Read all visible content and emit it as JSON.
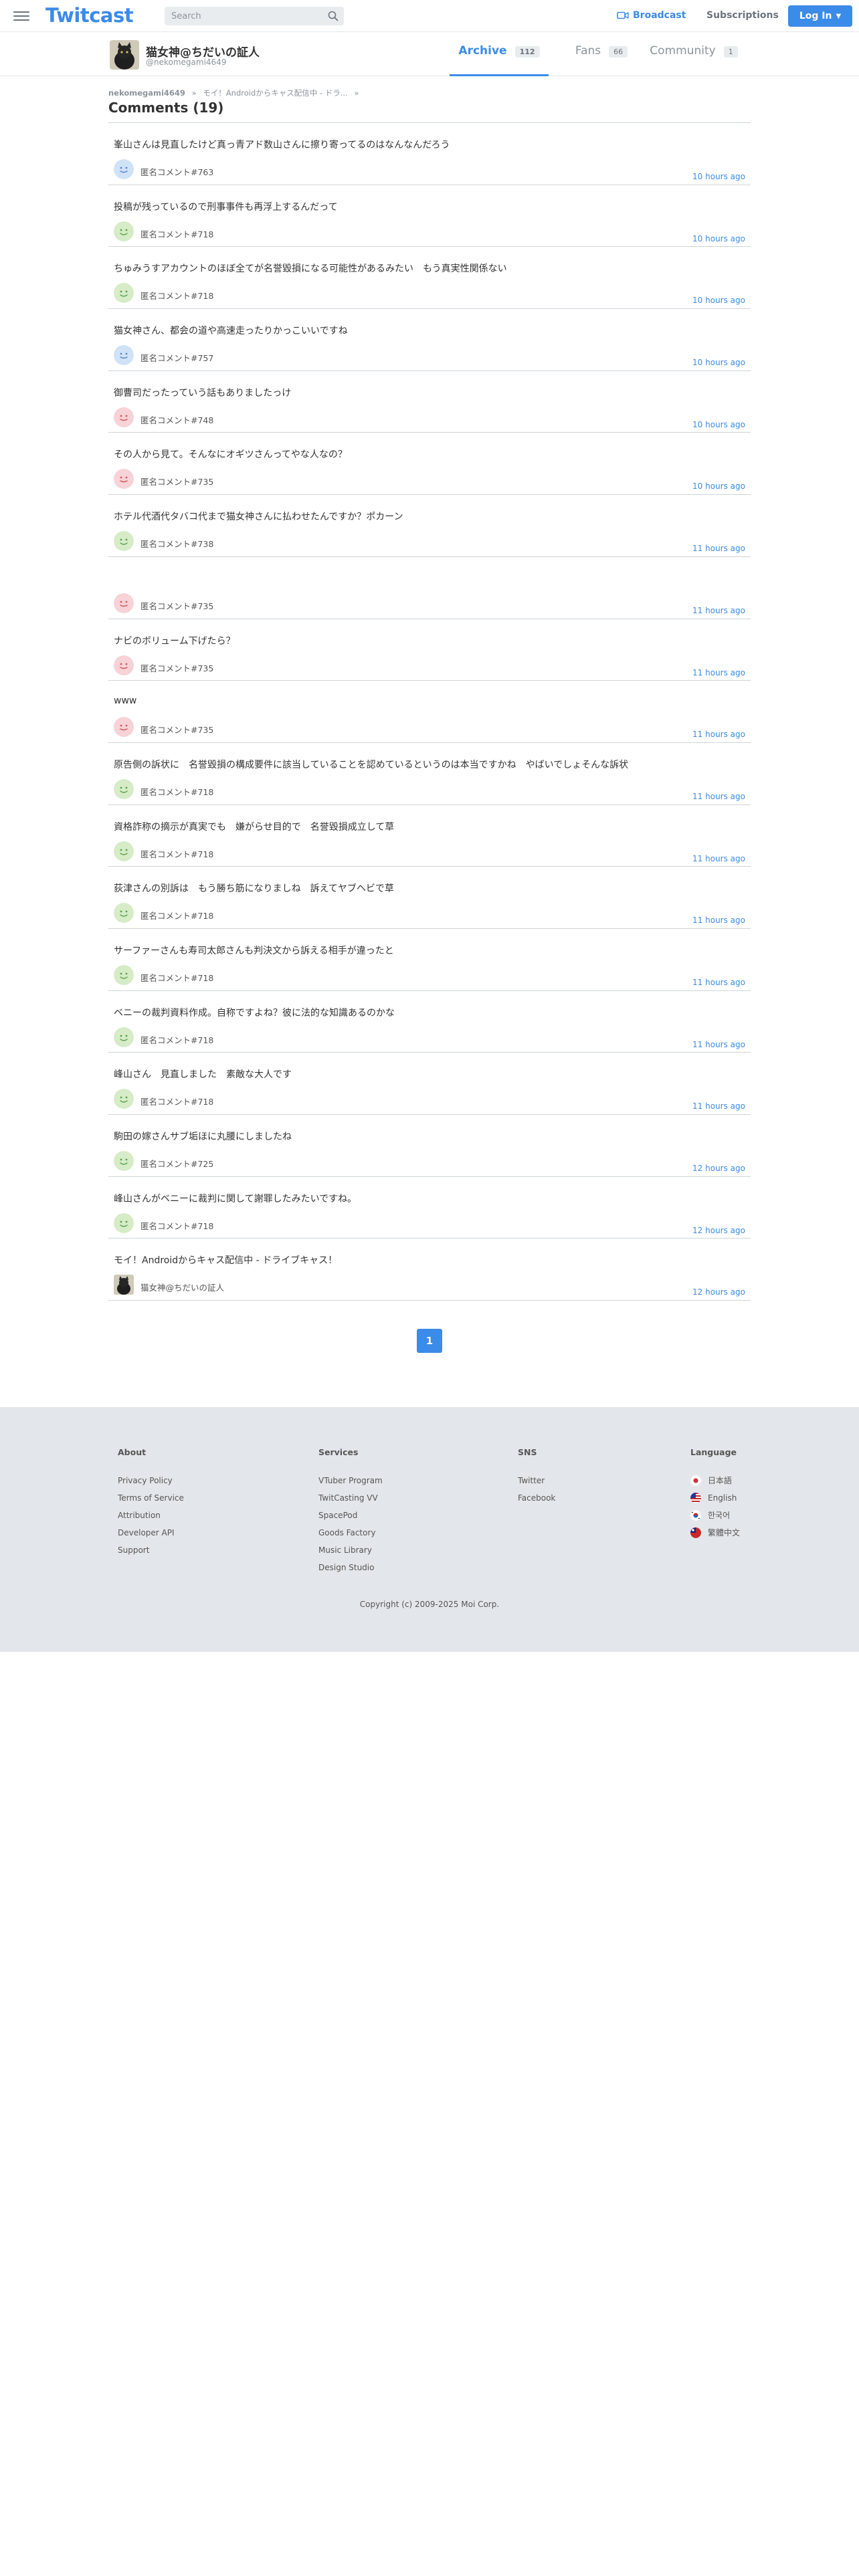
{
  "header": {
    "logo": "Twitcast",
    "search_placeholder": "Search",
    "broadcast": "Broadcast",
    "subscriptions": "Subscriptions",
    "login": "Log In",
    "accent": "#3b8be8"
  },
  "profile": {
    "name": "猫女神@ちだいの証人",
    "handle": "@nekomegami4649",
    "tabs": [
      {
        "label": "Archive",
        "count": "112"
      },
      {
        "label": "Fans",
        "count": "66"
      },
      {
        "label": "Community",
        "count": "1"
      }
    ]
  },
  "breadcrumb": {
    "user": "nekomegami4649",
    "page": "モイ！Androidからキャス配信中 - ドラ..."
  },
  "title": "Comments (19)",
  "comments": [
    {
      "text": "峯山さんは見直したけど真っ青アド数山さんに擦り寄ってるのはなんなんだろう",
      "author": "匿名コメント#763",
      "time": "10 hours ago",
      "face": "blue"
    },
    {
      "text": "投稿が残っているので刑事事件も再浮上するんだって",
      "author": "匿名コメント#718",
      "time": "10 hours ago",
      "face": "green"
    },
    {
      "text": "ちゅみうすアカウントのほぼ全てが名誉毀損になる可能性があるみたい　もう真実性関係ない",
      "author": "匿名コメント#718",
      "time": "10 hours ago",
      "face": "green"
    },
    {
      "text": "猫女神さん、都会の道や高速走ったりかっこいいですね",
      "author": "匿名コメント#757",
      "time": "10 hours ago",
      "face": "blue"
    },
    {
      "text": "御曹司だったっていう話もありましたっけ",
      "author": "匿名コメント#748",
      "time": "10 hours ago",
      "face": "red"
    },
    {
      "text": "その人から見て。そんなにオギツさんってやな人なの？",
      "author": "匿名コメント#735",
      "time": "10 hours ago",
      "face": "red"
    },
    {
      "text": "ホテル代酒代タバコ代まで猫女神さんに払わせたんですか？ポカーン",
      "author": "匿名コメント#738",
      "time": "11 hours ago",
      "face": "green"
    },
    {
      "text": "",
      "author": "匿名コメント#735",
      "time": "11 hours ago",
      "face": "red"
    },
    {
      "text": "ナビのボリューム下げたら？",
      "author": "匿名コメント#735",
      "time": "11 hours ago",
      "face": "red"
    },
    {
      "text": "www",
      "author": "匿名コメント#735",
      "time": "11 hours ago",
      "face": "red"
    },
    {
      "text": "原告側の訴状に　名誉毀損の構成要件に該当していることを認めているというのは本当ですかね　やばいでしょそんな訴状",
      "author": "匿名コメント#718",
      "time": "11 hours ago",
      "face": "green"
    },
    {
      "text": "資格詐称の摘示が真実でも　嫌がらせ目的で　名誉毀損成立して草",
      "author": "匿名コメント#718",
      "time": "11 hours ago",
      "face": "green"
    },
    {
      "text": "荻津さんの別訴は　もう勝ち筋になりましね　訴えてヤブヘビで草",
      "author": "匿名コメント#718",
      "time": "11 hours ago",
      "face": "green"
    },
    {
      "text": "サーファーさんも寿司太郎さんも判決文から訴える相手が違ったと",
      "author": "匿名コメント#718",
      "time": "11 hours ago",
      "face": "green"
    },
    {
      "text": "ベニーの裁判資料作成。自称ですよね？彼に法的な知識あるのかな",
      "author": "匿名コメント#718",
      "time": "11 hours ago",
      "face": "green"
    },
    {
      "text": "峰山さん　見直しました　素敵な大人です",
      "author": "匿名コメント#718",
      "time": "11 hours ago",
      "face": "green"
    },
    {
      "text": "駒田の嫁さんサブ垢ほに丸腰にしましたね",
      "author": "匿名コメント#725",
      "time": "12 hours ago",
      "face": "green"
    },
    {
      "text": "峰山さんがベニーに裁判に関して謝罪したみたいですね。",
      "author": "匿名コメント#718",
      "time": "12 hours ago",
      "face": "green"
    },
    {
      "text": "モイ！Androidからキャス配信中 - ドライブキャス！",
      "author": "猫女神@ちだいの証人",
      "time": "12 hours ago",
      "face": "cat"
    }
  ],
  "pagination": {
    "current": "1"
  },
  "footer": {
    "about": {
      "heading": "About",
      "links": [
        "Privacy Policy",
        "Terms of Service",
        "Attribution",
        "Developer API",
        "Support"
      ]
    },
    "services": {
      "heading": "Services",
      "links": [
        "VTuber Program",
        "TwitCasting VV",
        "SpacePod",
        "Goods Factory",
        "Music Library",
        "Design Studio"
      ]
    },
    "sns": {
      "heading": "SNS",
      "links": [
        "Twitter",
        "Facebook"
      ]
    },
    "language": {
      "heading": "Language",
      "links": [
        "日本語",
        "English",
        "한국어",
        "繁體中文"
      ]
    },
    "copyright": "Copyright (c) 2009-2025 Moi Corp."
  }
}
